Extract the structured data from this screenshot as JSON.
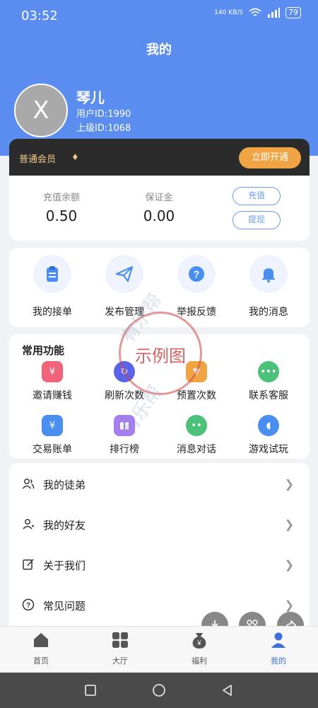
{
  "status": {
    "time": "03:52",
    "net_speed": "140 KB/S",
    "battery": "79"
  },
  "header": {
    "title": "我的"
  },
  "profile": {
    "avatar_letter": "X",
    "name": "琴儿",
    "user_id": "用户ID:1990",
    "parent_id": "上级ID:1068"
  },
  "membership": {
    "level": "普通会员",
    "open_button": "立即开通"
  },
  "balance": {
    "recharge_label": "充值余额",
    "recharge_value": "0.50",
    "deposit_label": "保证金",
    "deposit_value": "0.00",
    "recharge_button": "充值",
    "withdraw_button": "提现"
  },
  "actions": [
    {
      "label": "我的接单",
      "icon": "clipboard-icon"
    },
    {
      "label": "发布管理",
      "icon": "paper-plane-icon"
    },
    {
      "label": "举报反馈",
      "icon": "question-icon"
    },
    {
      "label": "我的消息",
      "icon": "bell-icon"
    }
  ],
  "functions": {
    "title": "常用功能",
    "items": [
      {
        "label": "邀请赚钱",
        "icon": "money-bag-icon",
        "color": "#f0637a"
      },
      {
        "label": "刷新次数",
        "icon": "refresh-icon",
        "color": "#5b63e8"
      },
      {
        "label": "预置次数",
        "icon": "pin-icon",
        "color": "#f0a444"
      },
      {
        "label": "联系客服",
        "icon": "chat-icon",
        "color": "#4cc17a"
      },
      {
        "label": "交易账单",
        "icon": "bill-icon",
        "color": "#4a8ff0"
      },
      {
        "label": "排行榜",
        "icon": "ranking-icon",
        "color": "#a77ef0"
      },
      {
        "label": "消息对话",
        "icon": "wechat-icon",
        "color": "#4cc17a"
      },
      {
        "label": "游戏试玩",
        "icon": "gamepad-icon",
        "color": "#4a8ff0"
      }
    ]
  },
  "menu": [
    {
      "label": "我的徒弟",
      "icon": "users-icon"
    },
    {
      "label": "我的好友",
      "icon": "user-add-icon"
    },
    {
      "label": "关于我们",
      "icon": "edit-icon"
    },
    {
      "label": "常见问题",
      "icon": "help-icon"
    }
  ],
  "watermark": {
    "stamp": "示例图",
    "diagonal": "有乐帮"
  },
  "tabbar": [
    {
      "label": "首页",
      "icon": "home-icon",
      "active": false
    },
    {
      "label": "大厅",
      "icon": "grid-icon",
      "active": false
    },
    {
      "label": "福利",
      "icon": "welfare-icon",
      "active": false
    },
    {
      "label": "我的",
      "icon": "person-icon",
      "active": true
    }
  ],
  "colors": {
    "header_bg": "#5a8def",
    "accent": "#6c9af0",
    "member_bar": "#2b2b2b",
    "gold": "#f0c88c",
    "open_button": "#f0a444"
  }
}
